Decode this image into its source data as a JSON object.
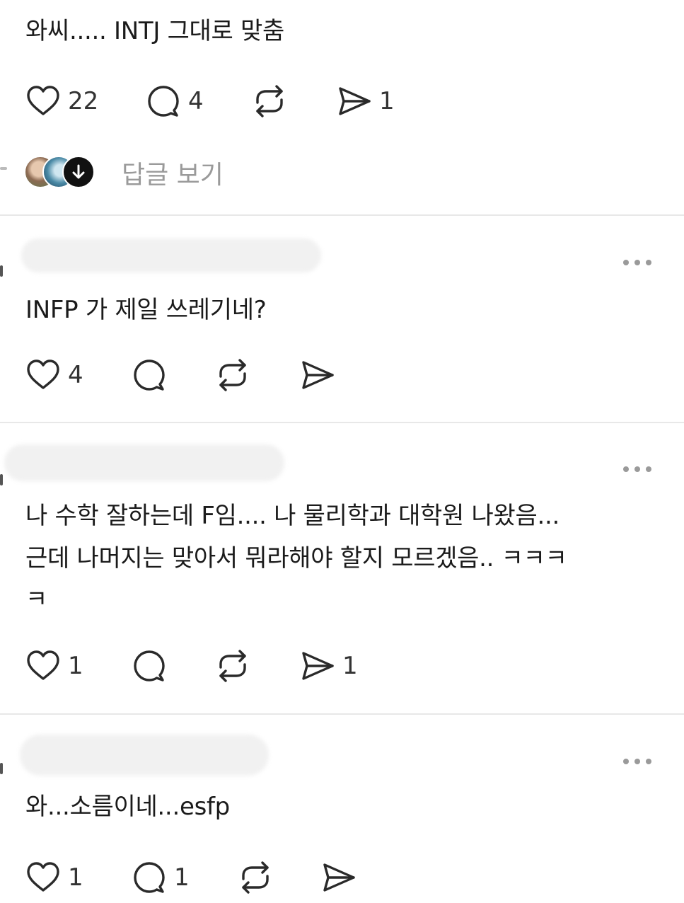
{
  "posts": [
    {
      "text": "와씨..... INTJ 그대로 맞춤",
      "likes": "22",
      "replies": "4",
      "reposts": "",
      "shares": "1",
      "view_replies_label": "답글 보기"
    },
    {
      "username_partial": "Jut",
      "text": "INFP 가 제일 쓰레기네?",
      "likes": "4",
      "replies": "",
      "reposts": "",
      "shares": ""
    },
    {
      "text_line1": "나 수학 잘하는데 F임.... 나 물리학과 대학원 나왔음...",
      "text_line2": "근데 나머지는 맞아서 뭐라해야 할지 모르겠음.. ㅋㅋㅋ",
      "text_line3": "ㅋ",
      "likes": "1",
      "replies": "",
      "reposts": "",
      "shares": "1"
    },
    {
      "text": "와...소름이네...esfp",
      "likes": "1",
      "replies": "1",
      "reposts": "",
      "shares": ""
    }
  ],
  "icons": {
    "like": "heart-icon",
    "reply": "comment-bubble-icon",
    "repost": "repost-icon",
    "share": "send-icon",
    "more": "more-options-icon"
  },
  "colors": {
    "text": "#1b1b1b",
    "muted": "#9a9a9a",
    "icon": "#2a2a2a",
    "divider": "#e8e8e8"
  }
}
